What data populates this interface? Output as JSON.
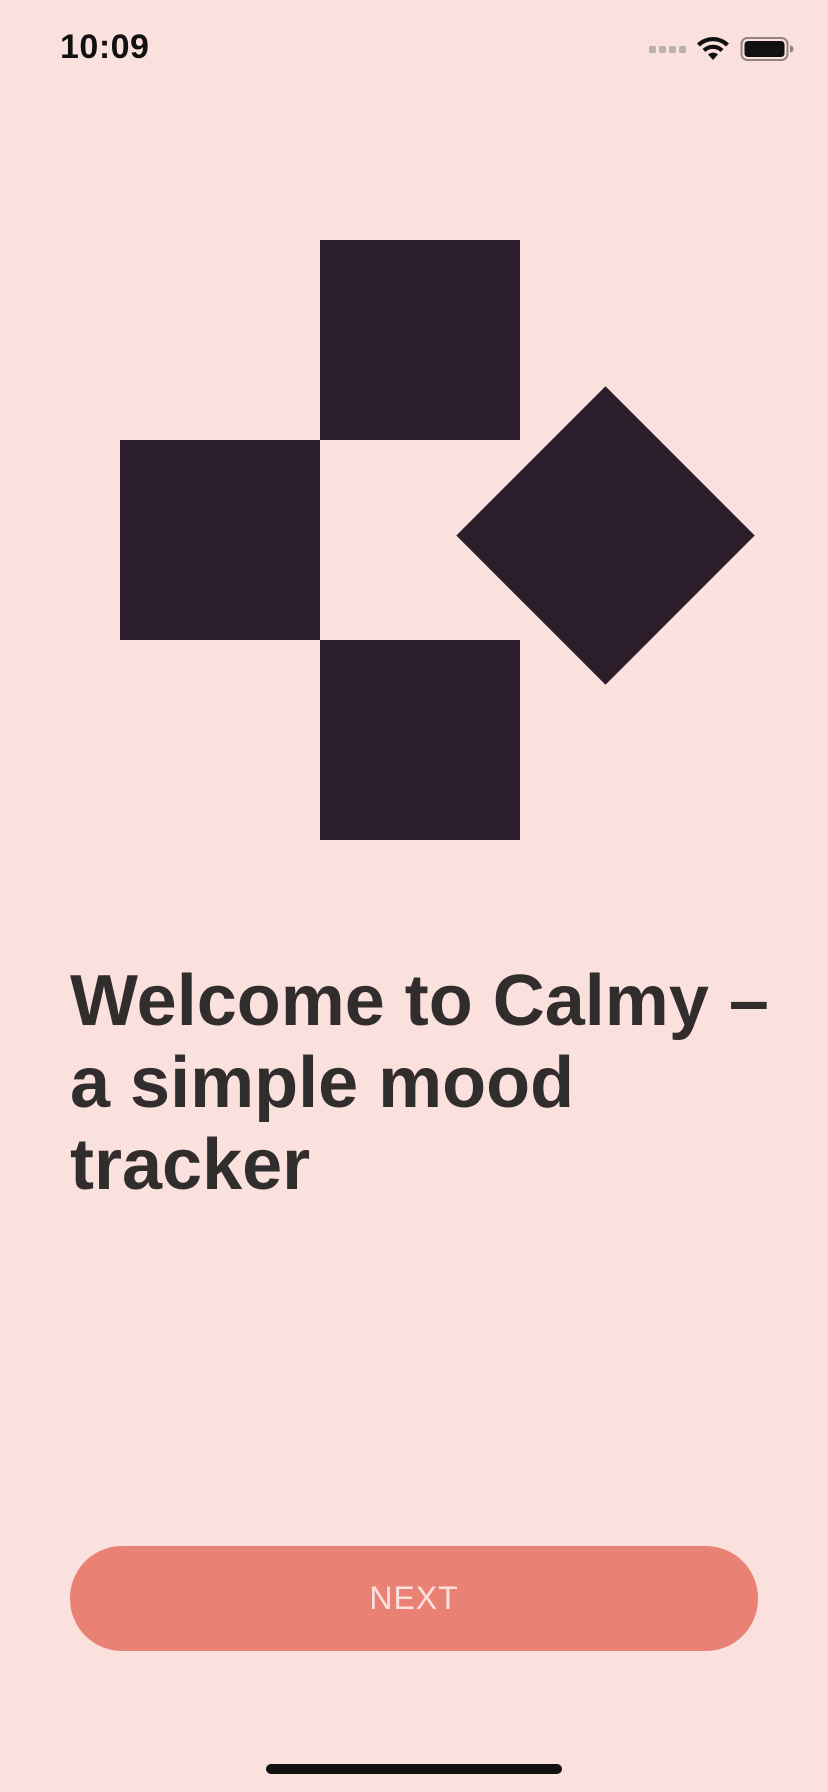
{
  "status_bar": {
    "time": "10:09",
    "icons": [
      "signal-icon",
      "wifi-icon",
      "battery-icon"
    ]
  },
  "logo": {
    "name": "calmy-logo",
    "color": "#2B1E2A"
  },
  "onboarding": {
    "headline": "Welcome to Calmy – a simple mood tracker"
  },
  "actions": {
    "next_label": "NEXT",
    "next_color": "#E98274"
  },
  "theme": {
    "background": "#FBE1DE",
    "text": "#322D2D"
  }
}
